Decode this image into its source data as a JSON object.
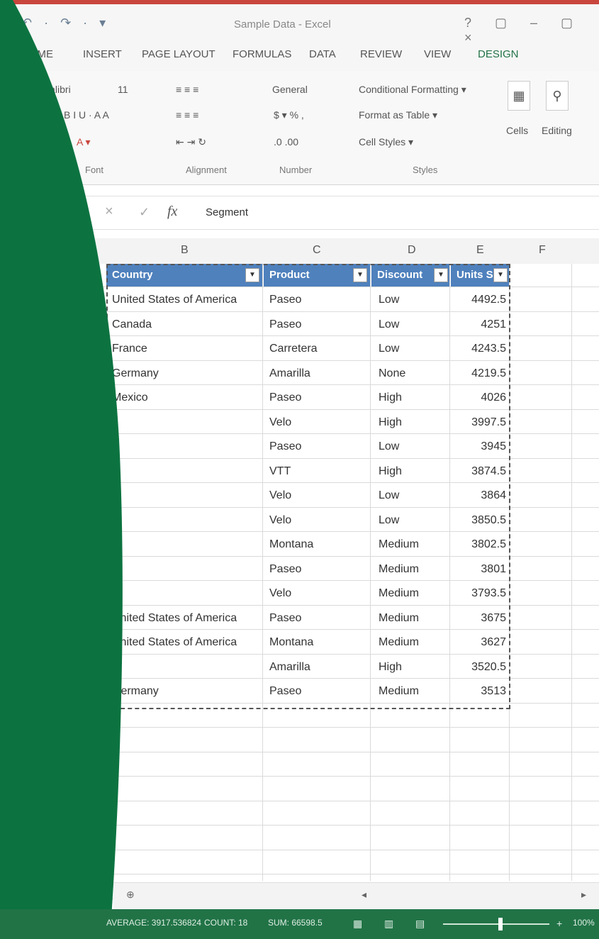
{
  "colors": {
    "accent_green": "#0c7340",
    "table_header": "#4f81bd",
    "status_green": "#217346",
    "title_red": "#c9463d"
  },
  "window": {
    "title": "Sample Data - Excel",
    "controls": "? ▢ – ▢ ×"
  },
  "quick_access": "↶ · ↷ · ▾",
  "ribbon_tabs": [
    "HOME",
    "INSERT",
    "PAGE LAYOUT",
    "FORMULAS",
    "DATA",
    "REVIEW",
    "VIEW",
    "DESIGN"
  ],
  "ribbon": {
    "font_name": "Calibri",
    "font_size": "11",
    "number_format": "General",
    "conditional_formatting": "Conditional Formatting ▾",
    "format_as_table": "Format as Table ▾",
    "cell_styles": "Cell Styles ▾",
    "cells": "Cells",
    "editing": "Editing",
    "groups": {
      "font": "Font",
      "alignment": "Alignment",
      "number": "Number",
      "styles": "Styles"
    }
  },
  "formula_bar": {
    "fx": "fx",
    "content": "Segment"
  },
  "column_headers": [
    "B",
    "C",
    "D",
    "E",
    "F"
  ],
  "table": {
    "headers": [
      "Country",
      "Product",
      "Discount",
      "Units S"
    ],
    "rows": [
      [
        "United States of America",
        "Paseo",
        "Low",
        "4492.5"
      ],
      [
        "Canada",
        "Paseo",
        "Low",
        "4251"
      ],
      [
        "France",
        "Carretera",
        "Low",
        "4243.5"
      ],
      [
        "Germany",
        "Amarilla",
        "None",
        "4219.5"
      ],
      [
        "Mexico",
        "Paseo",
        "High",
        "4026"
      ],
      [
        "",
        "Velo",
        "High",
        "3997.5"
      ],
      [
        "",
        "Paseo",
        "Low",
        "3945"
      ],
      [
        "",
        "VTT",
        "High",
        "3874.5"
      ],
      [
        "",
        "Velo",
        "Low",
        "3864"
      ],
      [
        "",
        "Velo",
        "Low",
        "3850.5"
      ],
      [
        "",
        "Montana",
        "Medium",
        "3802.5"
      ],
      [
        "",
        "Paseo",
        "Medium",
        "3801"
      ],
      [
        "",
        "Velo",
        "Medium",
        "3793.5"
      ],
      [
        "United States of America",
        "Paseo",
        "Medium",
        "3675"
      ],
      [
        "United States of America",
        "Montana",
        "Medium",
        "3627"
      ],
      [
        "",
        "Amarilla",
        "High",
        "3520.5"
      ],
      [
        "Germany",
        "Paseo",
        "Medium",
        "3513"
      ]
    ]
  },
  "status_bar": {
    "average": "AVERAGE: 3917.536824",
    "count": "COUNT: 18",
    "sum": "SUM: 66598.5",
    "zoom": "100%"
  }
}
